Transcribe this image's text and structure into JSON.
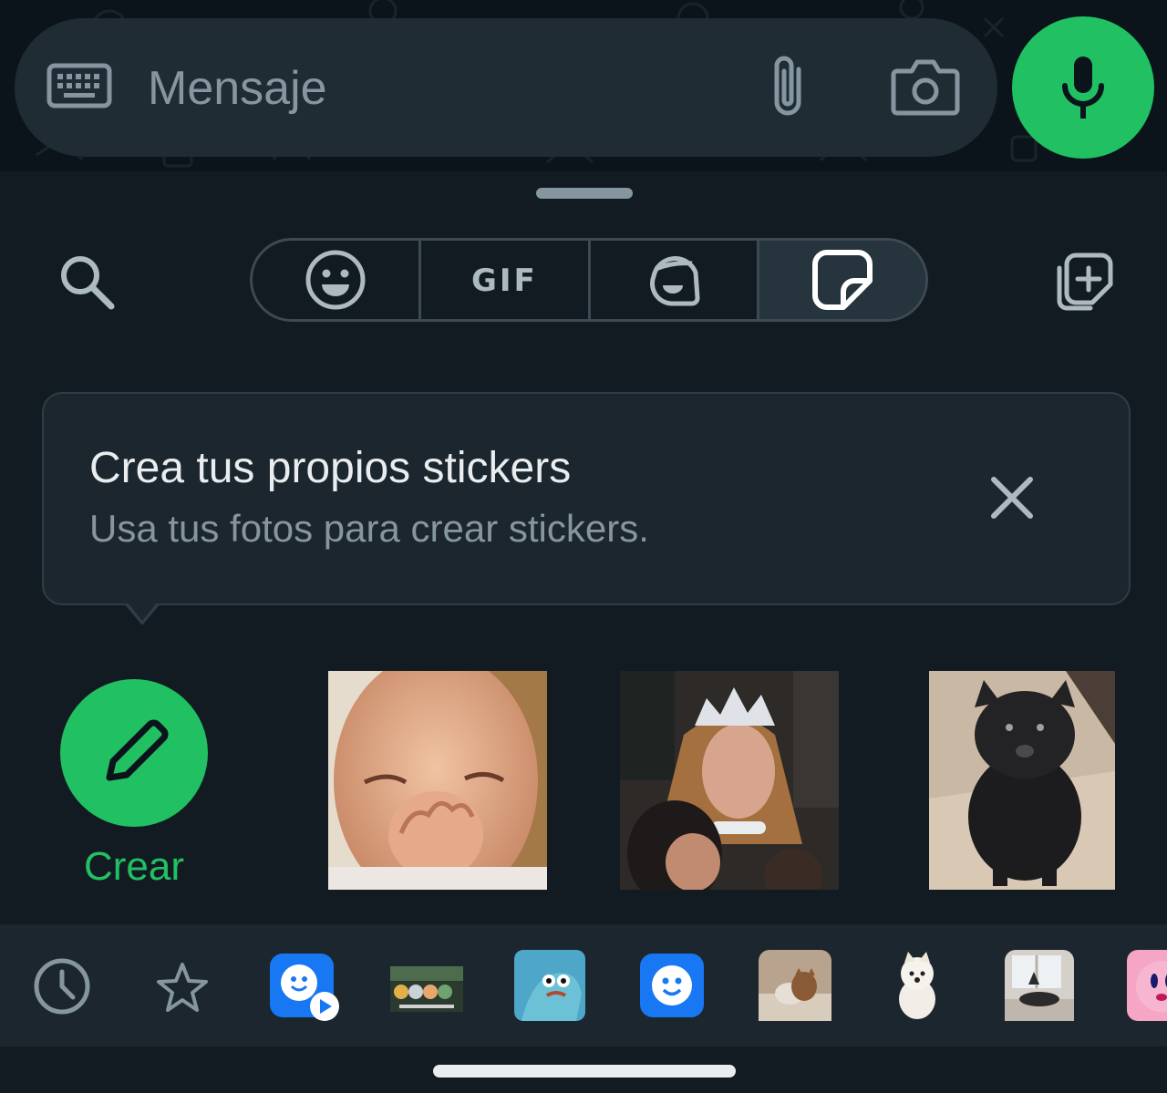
{
  "composer": {
    "placeholder": "Mensaje",
    "keyboard_icon": "keyboard-icon",
    "attach_icon": "paperclip-icon",
    "camera_icon": "camera-icon",
    "mic_icon": "microphone-icon"
  },
  "panel": {
    "search_icon": "search-icon",
    "tabs": [
      {
        "name": "emoji",
        "icon": "smiley-icon"
      },
      {
        "name": "gif",
        "label": "GIF"
      },
      {
        "name": "avatar",
        "icon": "avatar-icon"
      },
      {
        "name": "stickers",
        "icon": "sticker-icon",
        "selected": true
      }
    ],
    "add_pack_icon": "add-sticker-pack-icon"
  },
  "tip": {
    "title": "Crea tus propios stickers",
    "subtitle": "Usa tus fotos para crear stickers.",
    "close_icon": "close-icon"
  },
  "create": {
    "label": "Crear",
    "icon": "pencil-icon"
  },
  "stickers": [
    {
      "name": "baby-laughing-sticker"
    },
    {
      "name": "queen-with-tiara-sticker"
    },
    {
      "name": "black-dog-sticker"
    }
  ],
  "tray": [
    {
      "name": "recent",
      "icon": "clock-icon"
    },
    {
      "name": "favorites",
      "icon": "star-icon"
    },
    {
      "name": "animated-smiley-pack"
    },
    {
      "name": "cartoon-group-pack"
    },
    {
      "name": "fish-cartoon-pack"
    },
    {
      "name": "smiley-pack"
    },
    {
      "name": "cats-pack"
    },
    {
      "name": "white-dog-pack"
    },
    {
      "name": "cats-window-pack"
    },
    {
      "name": "pink-character-pack"
    }
  ],
  "colors": {
    "background": "#121b22",
    "surface": "#1f2c34",
    "accent": "#21c063",
    "text_primary": "#e9edef",
    "text_secondary": "#8696a0"
  }
}
